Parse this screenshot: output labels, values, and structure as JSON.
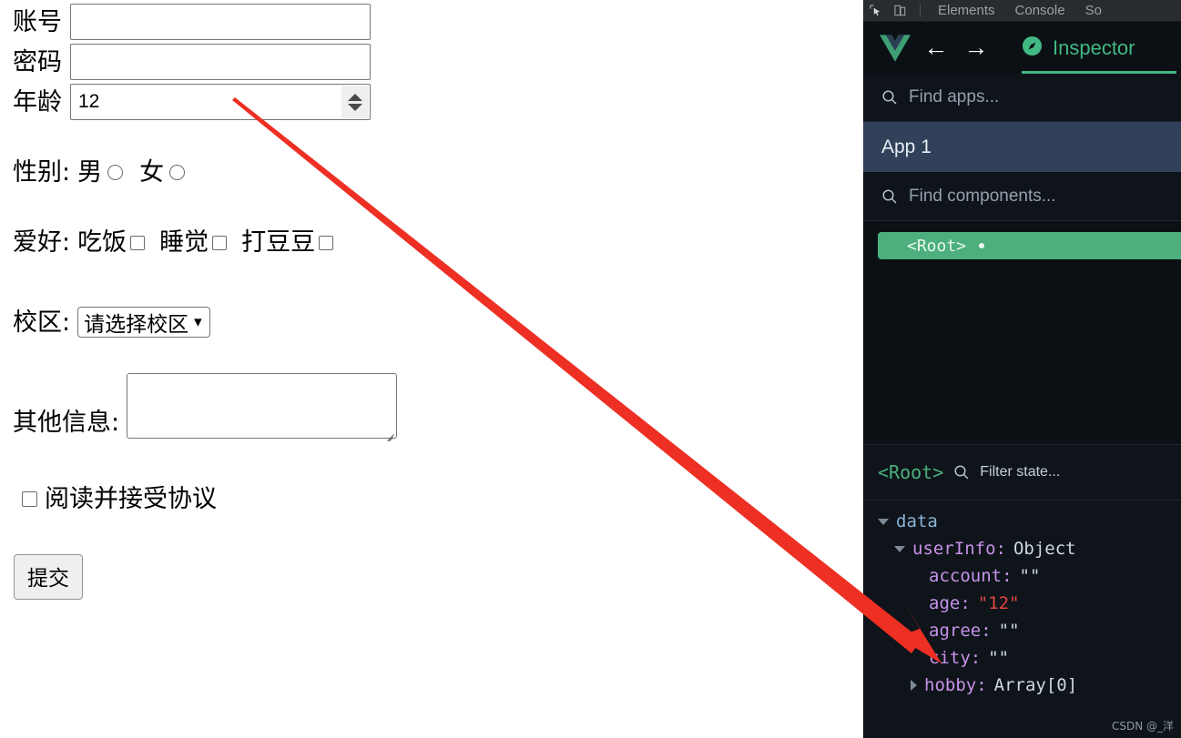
{
  "form": {
    "fields": [
      {
        "label": "账号",
        "value": "",
        "type": "text"
      },
      {
        "label": "密码",
        "value": "",
        "type": "password"
      },
      {
        "label": "年龄",
        "value": "12",
        "type": "number"
      }
    ],
    "gender": {
      "label": "性别:",
      "options": [
        {
          "label": "男",
          "checked": false
        },
        {
          "label": "女",
          "checked": false
        }
      ]
    },
    "hobby": {
      "label": "爱好:",
      "options": [
        {
          "label": "吃饭",
          "checked": false
        },
        {
          "label": "睡觉",
          "checked": false
        },
        {
          "label": "打豆豆",
          "checked": false
        }
      ]
    },
    "campus": {
      "label": "校区:",
      "selected": "请选择校区",
      "chevron": "chevron-down-icon"
    },
    "other": {
      "label": "其他信息:",
      "value": "",
      "placeholder": ""
    },
    "agreement": {
      "label": "阅读并接受协议",
      "checked": false
    },
    "submit_label": "提交"
  },
  "devtools": {
    "topbar": {
      "inspect_icon": "inspect-element-icon",
      "device_icon": "device-toolbar-icon",
      "tabs": [
        {
          "label": "Elements",
          "active": false
        },
        {
          "label": "Console",
          "active": false
        },
        {
          "label": "So",
          "active": false
        }
      ]
    },
    "vue_bar": {
      "logo": "vue-logo-icon",
      "back": "arrow-left-icon",
      "forward": "arrow-right-icon",
      "inspector_tab": "Inspector",
      "inspector_icon": "compass-icon",
      "accent": "#42b883"
    },
    "app_search": {
      "icon": "search-icon",
      "placeholder": "Find apps..."
    },
    "app_list": [
      {
        "label": "App 1",
        "selected": true
      }
    ],
    "component_search": {
      "icon": "search-icon",
      "placeholder": "Find components..."
    },
    "component_tree": [
      {
        "label": "<Root>",
        "selected": true,
        "badge": "•"
      }
    ],
    "state_panel": {
      "root_tag": "<Root>",
      "search_icon": "search-icon",
      "filter_placeholder": "Filter state...",
      "tree": [
        {
          "indent": 0,
          "caret": "down",
          "key": "data",
          "keyClass": "k-data",
          "colon": "",
          "value": "",
          "valueClass": ""
        },
        {
          "indent": 1,
          "caret": "down",
          "key": "userInfo",
          "keyClass": "k-prop",
          "colon": ":",
          "value": "Object",
          "valueClass": "v-type"
        },
        {
          "indent": 2,
          "caret": "none",
          "key": "account",
          "keyClass": "k-prop",
          "colon": ":",
          "value": "\"\"",
          "valueClass": "v-str"
        },
        {
          "indent": 2,
          "caret": "none",
          "key": "age",
          "keyClass": "k-prop",
          "colon": ":",
          "value": "\"12\"",
          "valueClass": "v-red"
        },
        {
          "indent": 2,
          "caret": "none",
          "key": "agree",
          "keyClass": "k-prop",
          "colon": ":",
          "value": "\"\"",
          "valueClass": "v-str"
        },
        {
          "indent": 2,
          "caret": "none",
          "key": "city",
          "keyClass": "k-prop",
          "colon": ":",
          "value": "\"\"",
          "valueClass": "v-str"
        },
        {
          "indent": 2,
          "caret": "right",
          "key": "hobby",
          "keyClass": "k-prop",
          "colon": ":",
          "value": "Array[0]",
          "valueClass": "v-type"
        }
      ]
    }
  },
  "annotation": {
    "arrow_color": "#ee2f24",
    "target": "age"
  },
  "watermark": "CSDN @_洋"
}
